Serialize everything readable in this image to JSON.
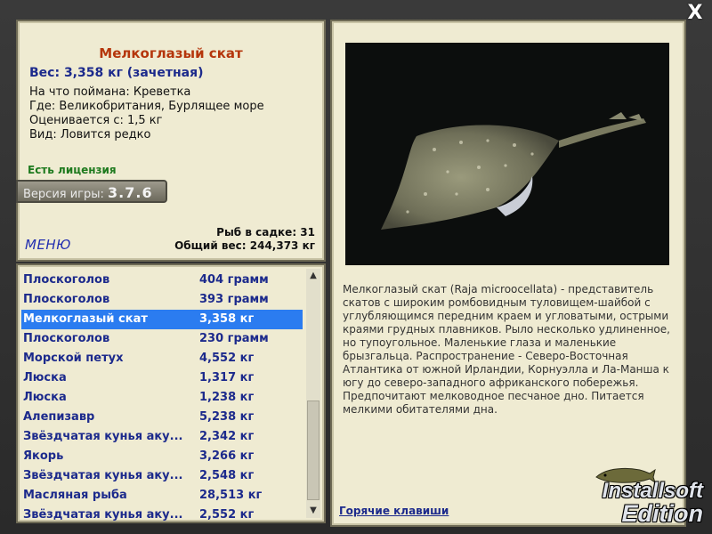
{
  "window": {
    "close_label": "X"
  },
  "fish": {
    "name": "Мелкоглазый скат",
    "weight_line": "Вес: 3,358 кг (зачетная)",
    "caught_on": "На что поймана: Креветка",
    "location": "Где: Великобритания, Бурлящее море",
    "valued_from": "Оценивается с: 1,5 кг",
    "species": "Вид: Ловится редко"
  },
  "license": "Есть лицензия",
  "version": {
    "label": "Версия игры:",
    "number": "3.7.6"
  },
  "menu_label": "МЕНЮ",
  "stats": {
    "in_keepnet": "Рыб в садке: 31",
    "total_weight": "Общий вес: 244,373 кг"
  },
  "catch_list": [
    {
      "name": "Плоскоголов",
      "weight": "404 грамм"
    },
    {
      "name": "Плоскоголов",
      "weight": "393 грамм"
    },
    {
      "name": "Мелкоглазый скат",
      "weight": "3,358 кг",
      "selected": true
    },
    {
      "name": "Плоскоголов",
      "weight": "230 грамм"
    },
    {
      "name": "Морской петух",
      "weight": "4,552 кг"
    },
    {
      "name": "Люска",
      "weight": "1,317 кг"
    },
    {
      "name": "Люска",
      "weight": "1,238 кг"
    },
    {
      "name": "Алепизавр",
      "weight": "5,238 кг"
    },
    {
      "name": "Звёздчатая кунья аку...",
      "weight": "2,342 кг"
    },
    {
      "name": "Якорь",
      "weight": "3,266 кг"
    },
    {
      "name": "Звёздчатая кунья аку...",
      "weight": "2,548 кг"
    },
    {
      "name": "Масляная рыба",
      "weight": "28,513 кг"
    },
    {
      "name": "Звёздчатая кунья аку...",
      "weight": "2,552 кг"
    }
  ],
  "description": "Мелкоглазый скат (Raja microocellata) - представитель скатов с широким ромбовидным туловищем-шайбой с углубляющимся передним краем и угловатыми, острыми краями грудных плавников. Рыло несколько удлиненное, но тупоугольное. Маленькие глаза и маленькие брызгальца. Распространение - Северо-Восточная Атлантика от южной Ирландии, Корнуэлла и Ла-Манша к югу до северо-западного африканского побережья. Предпочитают мелководное песчаное дно. Питается мелкими обитателями дна.",
  "hotkeys_label": "Горячие клавиши",
  "logo": {
    "line1": "Installsoft",
    "line2": "Edition"
  },
  "colors": {
    "selected_row": "#2b7cf0",
    "list_text": "#1c2a8c",
    "title": "#b5360c",
    "license": "#1e7a1e",
    "panel_bg": "#efebd2"
  }
}
